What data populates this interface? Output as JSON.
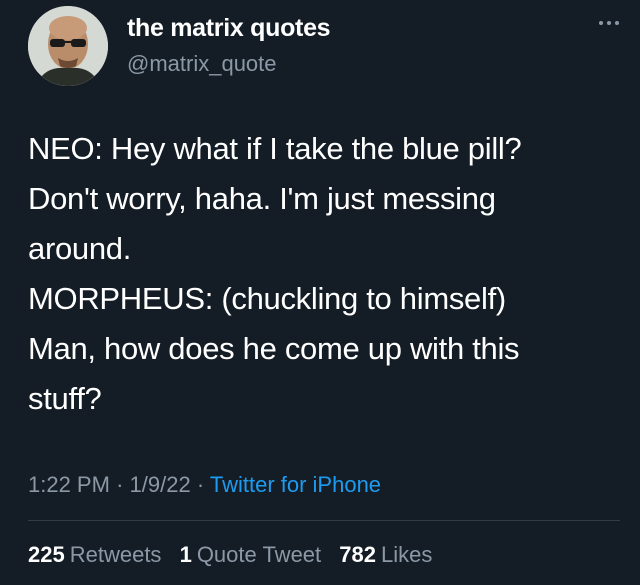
{
  "author": {
    "name": "the matrix quotes",
    "handle": "@matrix_quote"
  },
  "tweet": {
    "lines": [
      "NEO: Hey what if I take the blue pill?",
      "Don't worry, haha. I'm just messing",
      "around.",
      "MORPHEUS: (chuckling to himself)",
      "Man, how does he come up with this",
      "stuff?"
    ],
    "time": "1:22 PM",
    "date": "1/9/22",
    "separator": "·",
    "source": "Twitter for iPhone"
  },
  "stats": {
    "retweets": {
      "count": "225",
      "label": "Retweets"
    },
    "quotes": {
      "count": "1",
      "label": "Quote Tweet"
    },
    "likes": {
      "count": "782",
      "label": "Likes"
    }
  },
  "colors": {
    "background": "#141d26",
    "text": "#ffffff",
    "secondary": "#8b98a5",
    "link": "#1d9bf0"
  },
  "icons": {
    "more": "more-options-icon"
  }
}
